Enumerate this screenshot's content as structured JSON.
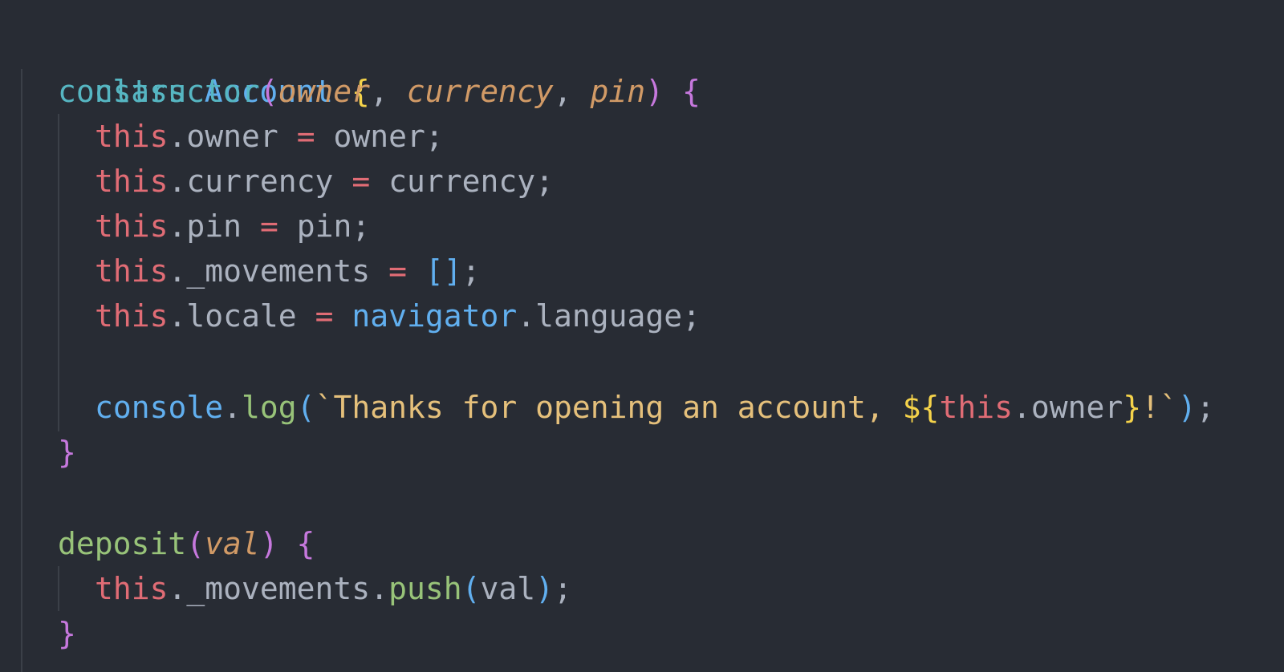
{
  "code": {
    "l1": {
      "kw": "class",
      "name": "Account",
      "brace": "{"
    },
    "l2": {
      "fn": "constructor",
      "open": "(",
      "p1": "owner",
      "c1": ", ",
      "p2": "currency",
      "c2": ", ",
      "p3": "pin",
      "close": ")",
      "brace": "{"
    },
    "l3": {
      "this": "this",
      "dot": ".",
      "prop": "owner",
      "eq": "=",
      "val": "owner",
      "semi": ";"
    },
    "l4": {
      "this": "this",
      "dot": ".",
      "prop": "currency",
      "eq": "=",
      "val": "currency",
      "semi": ";"
    },
    "l5": {
      "this": "this",
      "dot": ".",
      "prop": "pin",
      "eq": "=",
      "val": "pin",
      "semi": ";"
    },
    "l6": {
      "this": "this",
      "dot": ".",
      "prop": "_movements",
      "eq": "=",
      "val": "[]",
      "semi": ";"
    },
    "l7": {
      "this": "this",
      "dot": ".",
      "prop": "locale",
      "eq": "=",
      "obj": "navigator",
      "dot2": ".",
      "member": "language",
      "semi": ";"
    },
    "l9": {
      "obj": "console",
      "dot": ".",
      "fn": "log",
      "open": "(",
      "str1": "`Thanks for opening an account, ",
      "t_open": "${",
      "this": "this",
      "dot2": ".",
      "prop": "owner",
      "t_close": "}",
      "str2": "!`",
      "close": ")",
      "semi": ";"
    },
    "l10": {
      "brace": "}"
    },
    "l12": {
      "fn": "deposit",
      "open": "(",
      "p1": "val",
      "close": ")",
      "brace": "{"
    },
    "l13": {
      "this": "this",
      "dot": ".",
      "prop": "_movements",
      "dot2": ".",
      "fn": "push",
      "open": "(",
      "arg": "val",
      "close": ")",
      "semi": ";"
    },
    "l14": {
      "brace": "}"
    }
  }
}
